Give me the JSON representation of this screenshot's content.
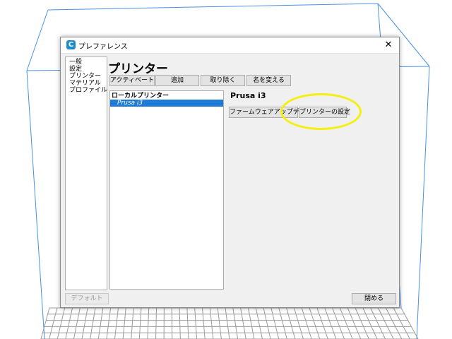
{
  "window": {
    "title": "プレファレンス",
    "app_icon_glyph": "C",
    "close_glyph": "✕"
  },
  "sidebar": {
    "items": [
      {
        "label": "一般"
      },
      {
        "label": "設定"
      },
      {
        "label": "プリンター"
      },
      {
        "label": "マテリアル"
      },
      {
        "label": "プロファイル"
      }
    ]
  },
  "main": {
    "heading": "プリンター",
    "toolbar": {
      "activate": "アクティベート",
      "add": "追加",
      "remove": "取り除く",
      "rename": "名を変える"
    },
    "list": {
      "group_header": "ローカルプリンター",
      "items": [
        {
          "label": "Prusa i3",
          "selected": true
        }
      ]
    },
    "selected_printer": {
      "name": "Prusa i3",
      "firmware_button": "ファームウェアアップデート",
      "settings_button": "プリンターの設定"
    }
  },
  "footer": {
    "defaults_button": "デフォルト",
    "close_button": "閉める"
  },
  "colors": {
    "selection": "#1e7bd6",
    "highlight_circle": "#f4ef10",
    "build_volume_lines": "#4a90e2",
    "build_plate_grid": "#9b9b9b"
  }
}
